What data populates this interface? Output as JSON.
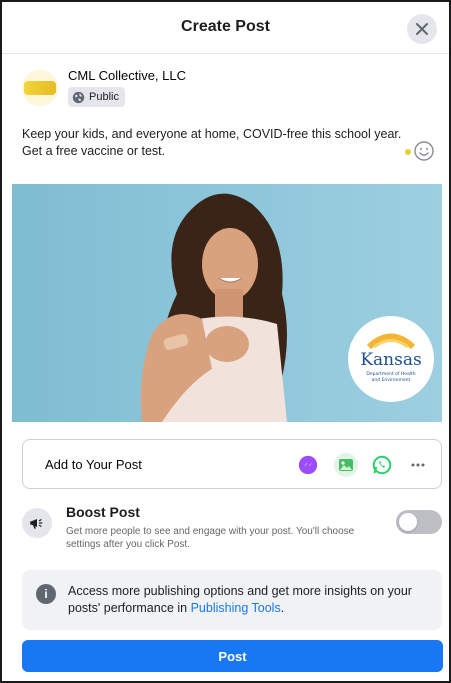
{
  "dialog": {
    "title": "Create Post"
  },
  "author": {
    "name": "CML Collective, LLC",
    "audience": "Public"
  },
  "post": {
    "message_line1": "Keep your kids, and everyone at home, COVID-free this school year.",
    "message_line2": "Get a free vaccine or test.",
    "image": {
      "logo_text": "Kansas",
      "logo_subtext_1": "Department of Health",
      "logo_subtext_2": "and Environment"
    }
  },
  "add_to_post": {
    "label": "Add to Your Post",
    "icons": [
      "messenger-icon",
      "photo-icon",
      "whatsapp-icon",
      "more-icon"
    ]
  },
  "boost": {
    "title": "Boost Post",
    "description": "Get more people to see and engage with your post. You'll choose settings after you click Post.",
    "enabled": false
  },
  "info": {
    "text": "Access more publishing options and get more insights on your posts' performance in ",
    "link": "Publishing Tools",
    "suffix": "."
  },
  "actions": {
    "post_label": "Post"
  },
  "colors": {
    "primary": "#1877f2",
    "messenger": "#9b4dff",
    "photo": "#45bd62",
    "whatsapp": "#25d366"
  }
}
